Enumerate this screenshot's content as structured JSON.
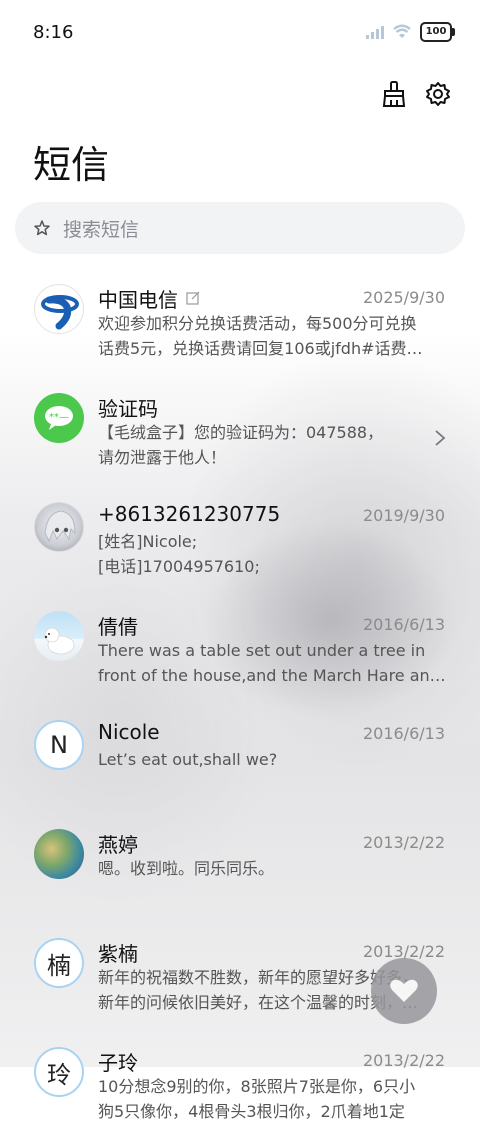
{
  "status": {
    "time": "8:16",
    "battery": "100"
  },
  "header": {
    "title": "短信"
  },
  "search": {
    "placeholder": "搜索短信"
  },
  "conversations": [
    {
      "name": "中国电信",
      "date": "2025/9/30",
      "line1": "欢迎参加积分兑换话费活动，每500分可兑换",
      "line2": "话费5元，兑换话费请回复106或jfdh#话费…"
    },
    {
      "name": "验证码",
      "date": "",
      "line1": "【毛绒盒子】您的验证码为：047588，",
      "line2": "请勿泄露于他人！"
    },
    {
      "name": "+8613261230775",
      "date": "2019/9/30",
      "line1": "[姓名]Nicole;",
      "line2": "[电话]17004957610;"
    },
    {
      "name": "倩倩",
      "date": "2016/6/13",
      "line1": "There was a table set out under a tree in",
      "line2": "front of the house,and the March Hare an…"
    },
    {
      "name": "Nicole",
      "date": "2016/6/13",
      "avatar_letter": "N",
      "line1": "Let’s eat out,shall we?",
      "line2": ""
    },
    {
      "name": "燕婷",
      "date": "2013/2/22",
      "line1": "嗯。收到啦。同乐同乐。",
      "line2": ""
    },
    {
      "name": "紫楠",
      "date": "2013/2/22",
      "avatar_letter": "楠",
      "line1": "新年的祝福数不胜数，新年的愿望好多好多，",
      "line2": "新年的问候依旧美好，在这个温馨的时刻，…"
    },
    {
      "name": "子玲",
      "date": "2013/2/22",
      "avatar_letter": "玲",
      "line1": "10分想念9别的你，8张照片7张是你，6只小",
      "line2": "狗5只像你，4根骨头3根归你，2爪着地1定"
    }
  ],
  "icons": {
    "clean": "broom-icon",
    "settings": "gear-icon",
    "search": "star-icon",
    "fab": "heart-icon"
  },
  "colors": {
    "telecom_blue": "#1a5fb4",
    "sms_green": "#4cc94c",
    "avatar_ring": "#a8d3f2"
  }
}
